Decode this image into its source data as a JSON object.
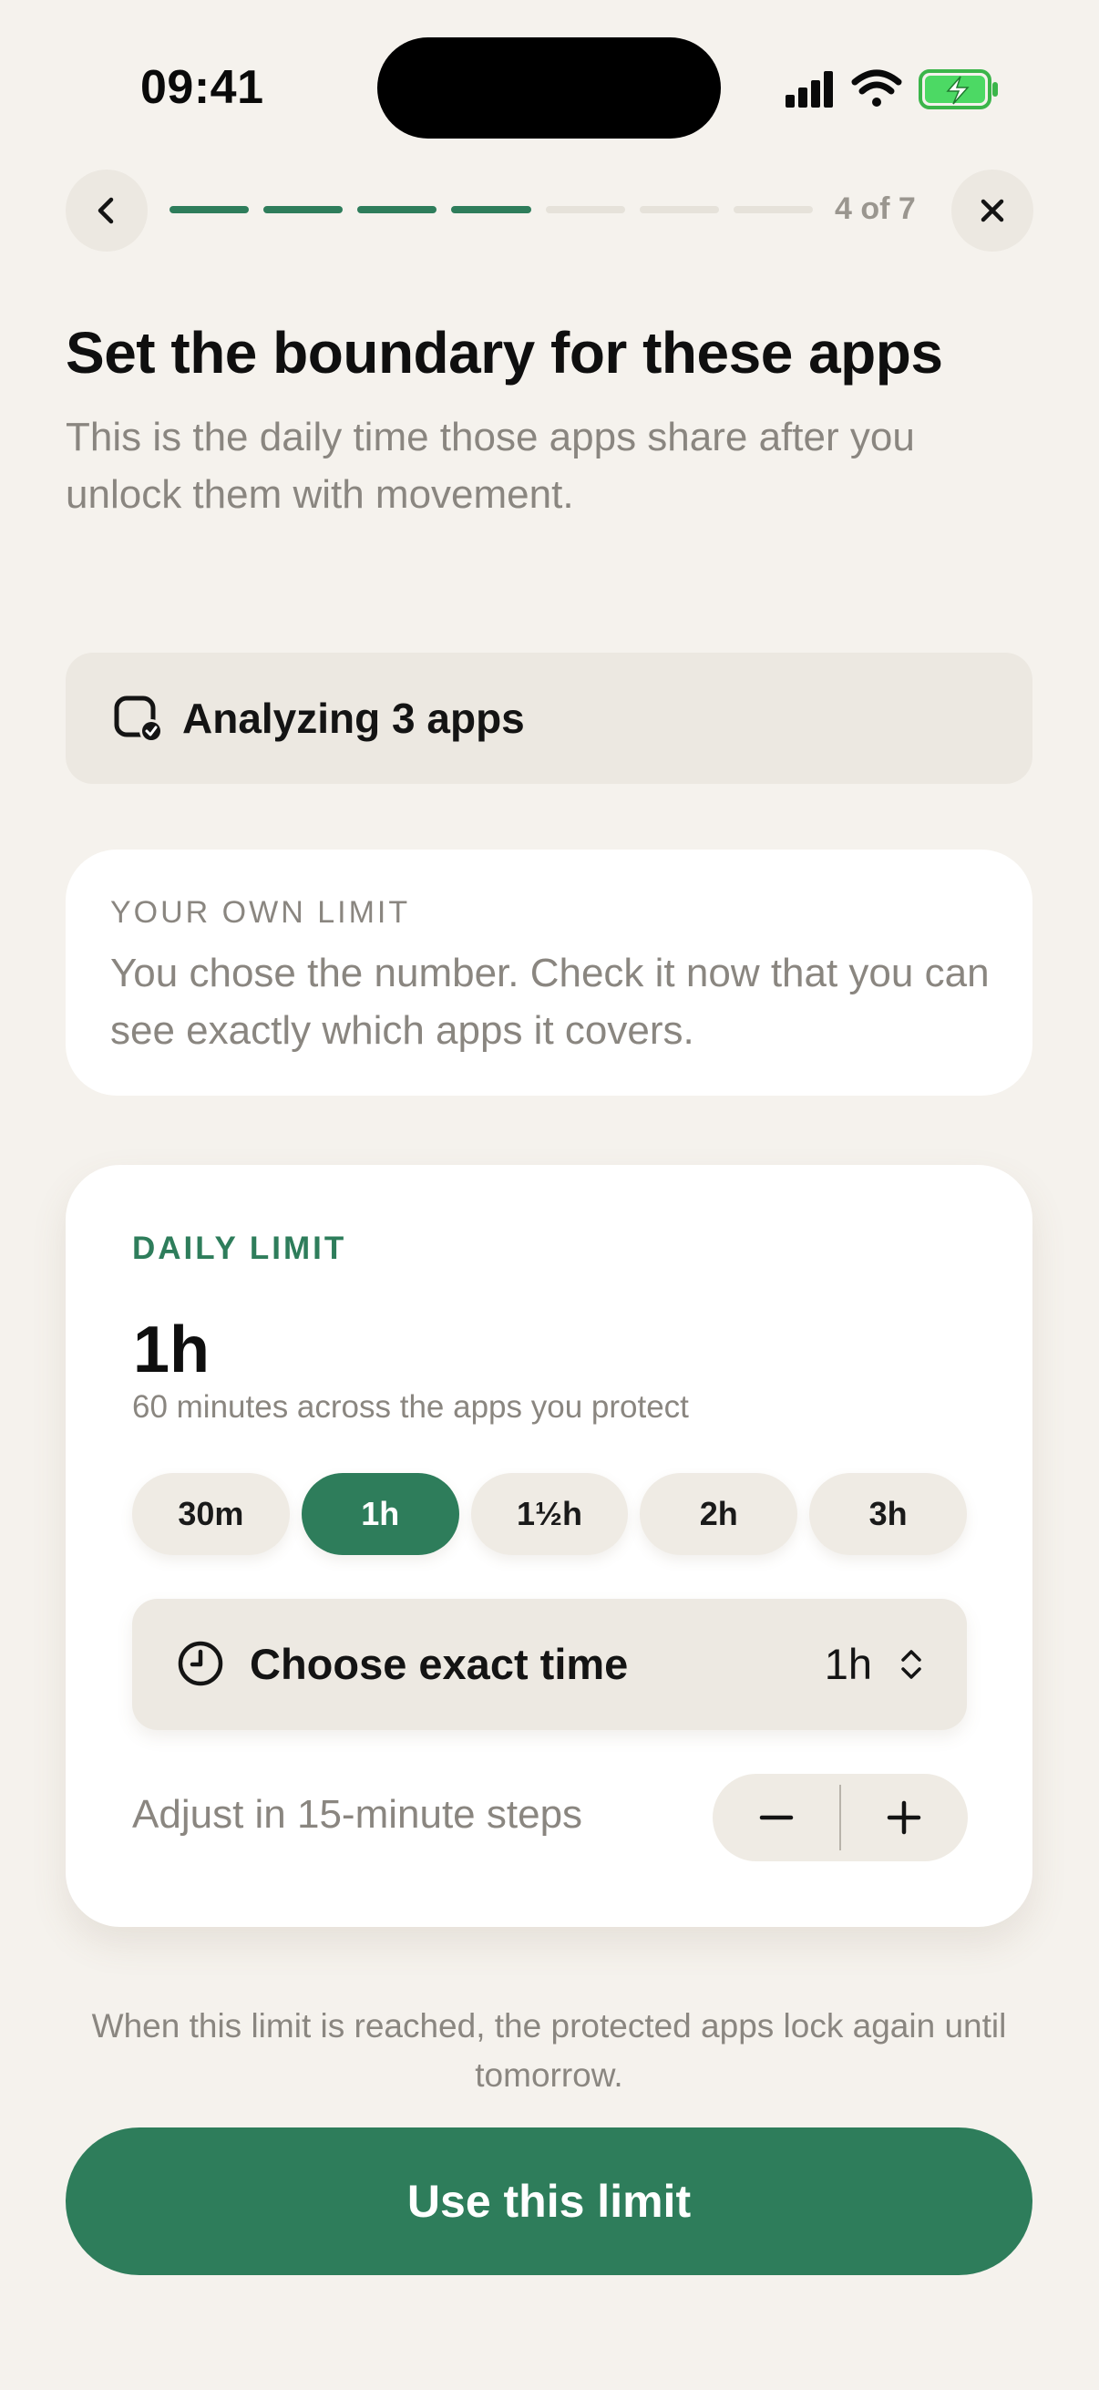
{
  "status_bar": {
    "time": "09:41"
  },
  "nav": {
    "step_text": "4 of 7",
    "progress": {
      "total_steps": 7,
      "completed_steps": 4
    },
    "back_icon": "chevron-left-icon",
    "close_icon": "close-icon"
  },
  "header": {
    "title": "Set the boundary for these apps",
    "subtitle": "This is the daily time those apps share after you unlock them with movement."
  },
  "analyzing": {
    "icon": "app-check-icon",
    "label": "Analyzing 3 apps"
  },
  "own_limit": {
    "eyebrow": "YOUR OWN LIMIT",
    "text": "You chose the number. Check it now that you can see exactly which apps it covers."
  },
  "daily_limit": {
    "eyebrow": "DAILY LIMIT",
    "value": "1h",
    "caption": "60 minutes across the apps you protect",
    "options": [
      "30m",
      "1h",
      "1½h",
      "2h",
      "3h"
    ],
    "selected_option": "1h",
    "exact_time": {
      "label": "Choose exact time",
      "value": "1h",
      "icon": "clock-icon"
    },
    "adjust_text": "Adjust in 15-minute steps"
  },
  "footer": {
    "note": "When this limit is reached, the protected apps lock again until tomorrow.",
    "cta_label": "Use this limit"
  },
  "colors": {
    "background": "#F5F2ED",
    "accent": "#2E7D5B",
    "muted_text": "#8A8680",
    "surface": "#FFFFFF",
    "chip": "#EFEBE4"
  }
}
